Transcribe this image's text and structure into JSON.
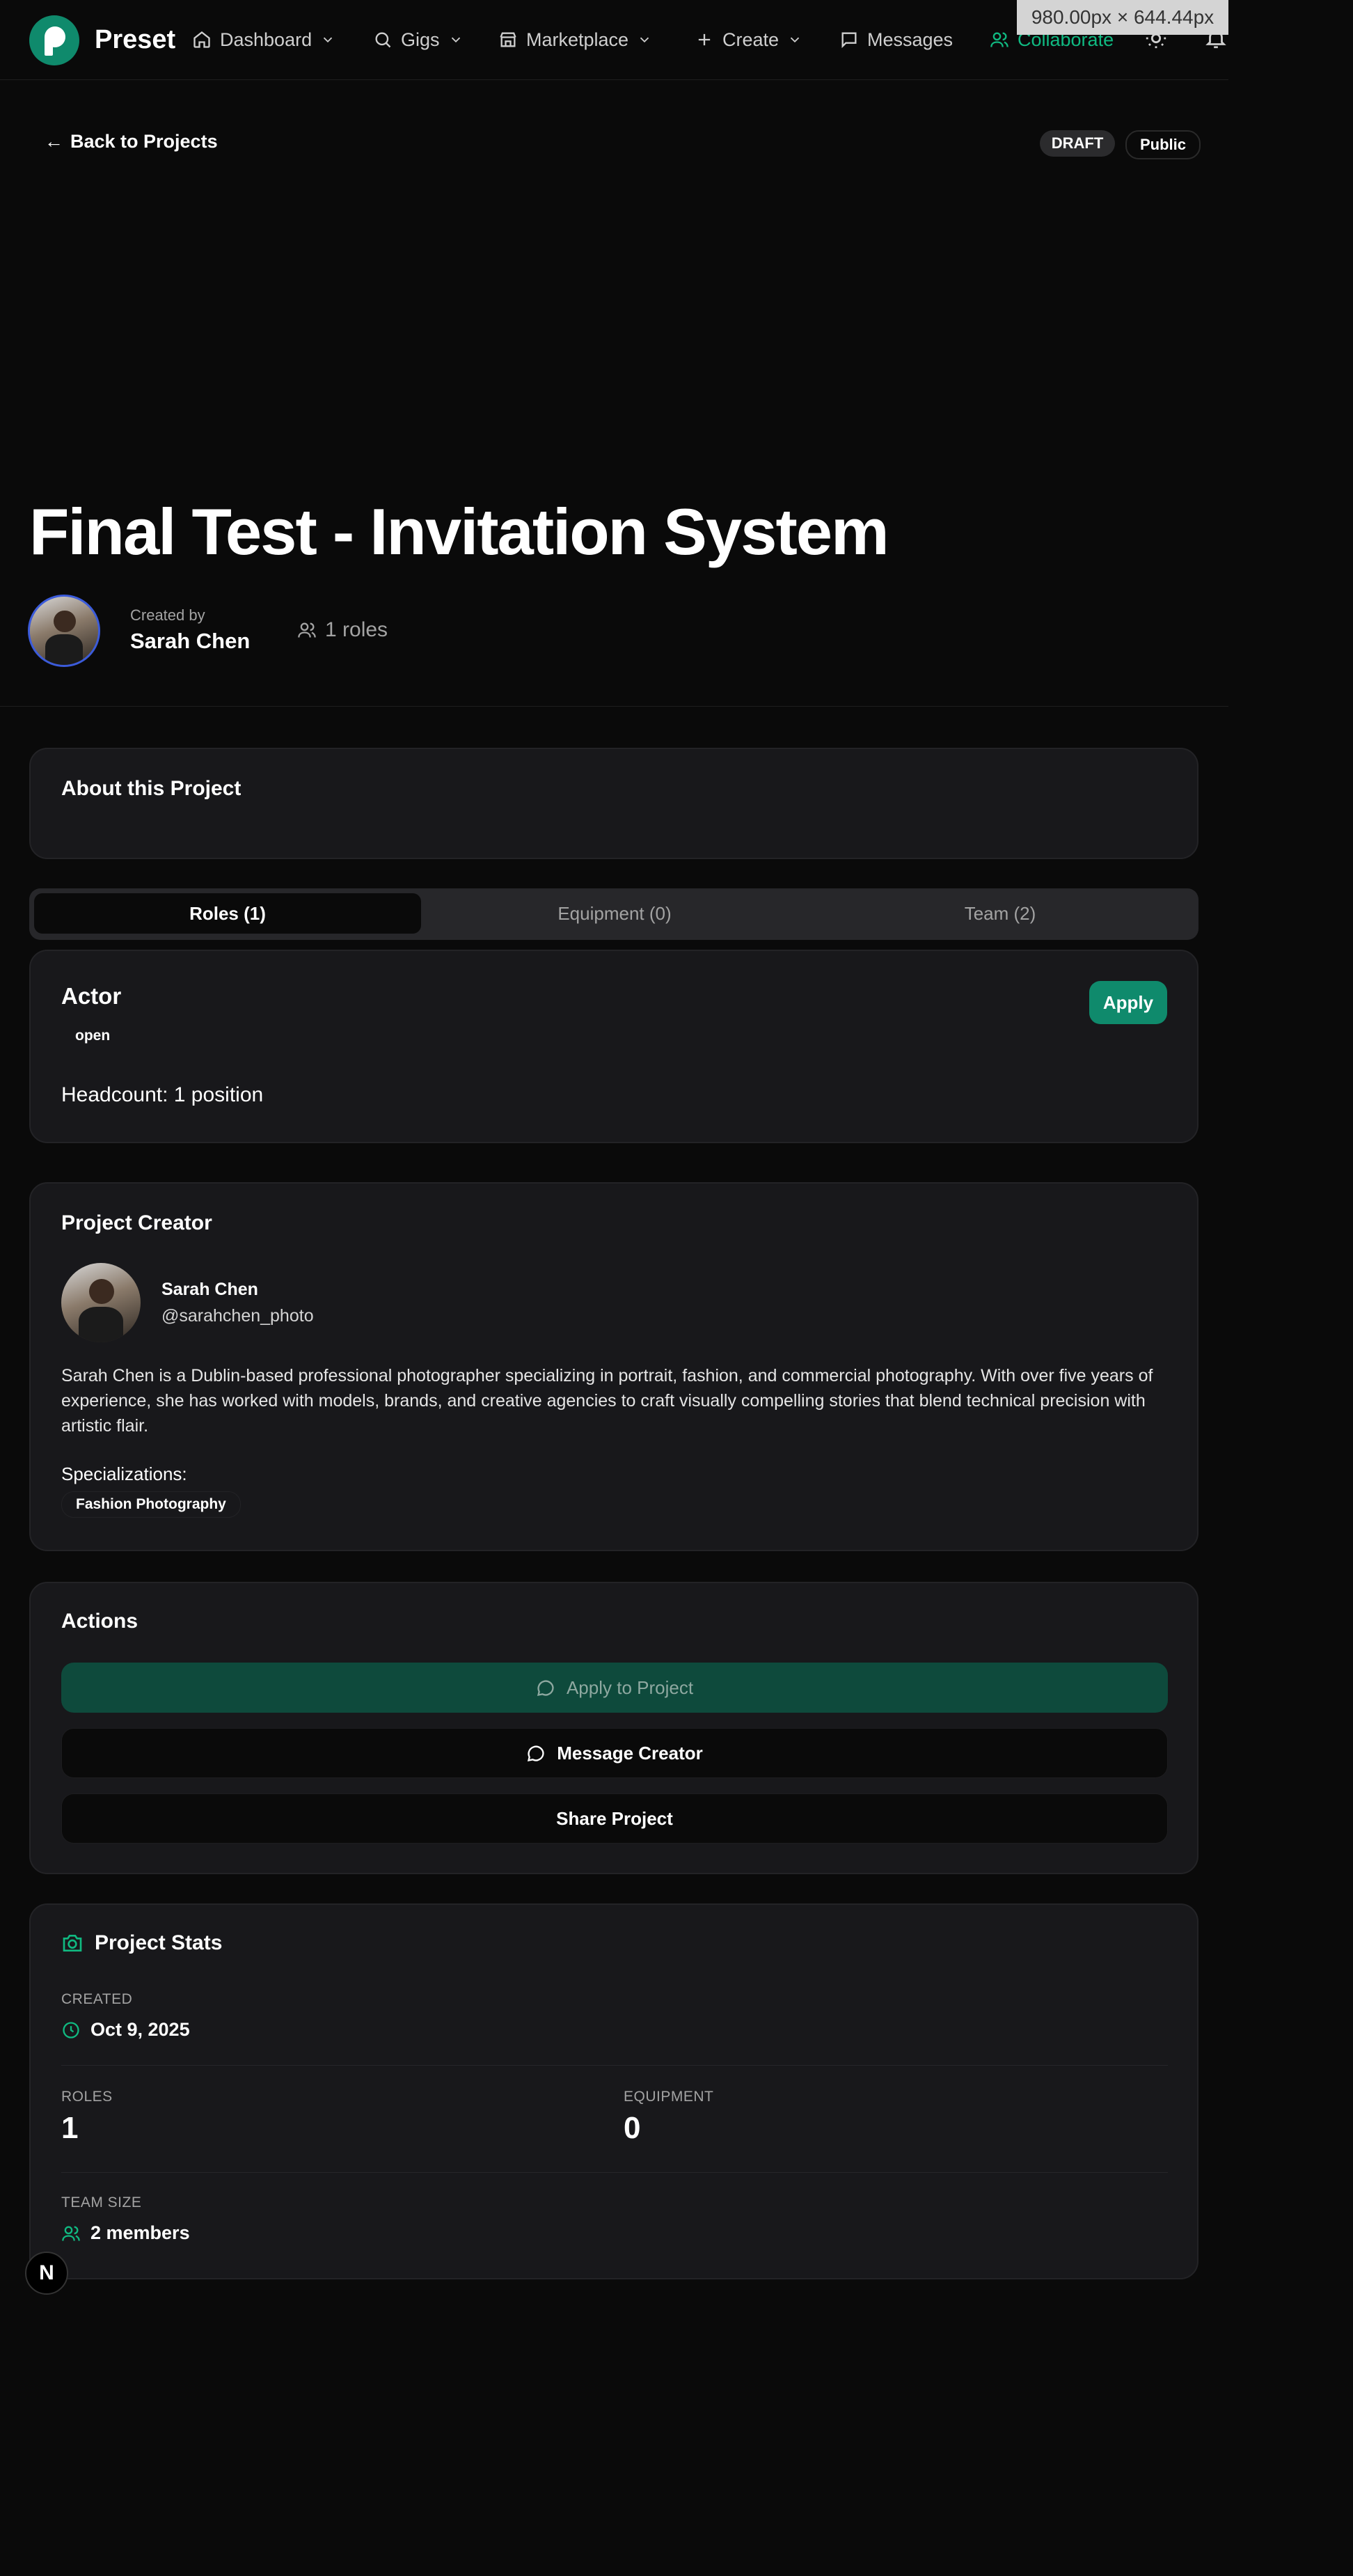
{
  "nav": {
    "brand": "Preset",
    "items": [
      {
        "label": "Dashboard",
        "icon": "home-icon"
      },
      {
        "label": "Gigs",
        "icon": "search-icon"
      },
      {
        "label": "Marketplace",
        "icon": "store-icon"
      },
      {
        "label": "Create",
        "icon": "plus-icon"
      },
      {
        "label": "Messages",
        "icon": "message-icon"
      },
      {
        "label": "Collaborate",
        "icon": "users-icon"
      }
    ],
    "dimension_badge": "980.00px × 644.44px"
  },
  "header": {
    "back_label": "Back to Projects",
    "status_badge": "DRAFT",
    "visibility_badge": "Public",
    "title": "Final Test - Invitation System",
    "created_by_label": "Created by",
    "creator_name": "Sarah Chen",
    "roles_count": "1 roles"
  },
  "about": {
    "title": "About this Project"
  },
  "tabs": [
    {
      "label": "Roles (1)",
      "active": true
    },
    {
      "label": "Equipment (0)",
      "active": false
    },
    {
      "label": "Team (2)",
      "active": false
    }
  ],
  "role": {
    "title": "Actor",
    "status": "open",
    "apply_label": "Apply",
    "headcount": "Headcount: 1 position"
  },
  "project_creator": {
    "title": "Project Creator",
    "name": "Sarah Chen",
    "handle": "@sarahchen_photo",
    "bio": "Sarah Chen is a Dublin-based professional photographer specializing in portrait, fashion, and commercial photography. With over five years of experience, she has worked with models, brands, and creative agencies to craft visually compelling stories that blend technical precision with artistic flair.",
    "specializations_label": "Specializations:",
    "specializations": [
      "Fashion Photography"
    ]
  },
  "actions": {
    "title": "Actions",
    "apply_label": "Apply to Project",
    "message_label": "Message Creator",
    "share_label": "Share Project"
  },
  "stats": {
    "title": "Project Stats",
    "created_label": "CREATED",
    "created_value": "Oct 9, 2025",
    "roles_label": "ROLES",
    "roles_value": "1",
    "equipment_label": "EQUIPMENT",
    "equipment_value": "0",
    "team_label": "TEAM SIZE",
    "team_value": "2 members"
  },
  "dev_badge": "N",
  "colors": {
    "accent": "#10b981",
    "accent_dark": "#0f8a6c",
    "background": "#0a0a0a",
    "card": "#18181b"
  }
}
